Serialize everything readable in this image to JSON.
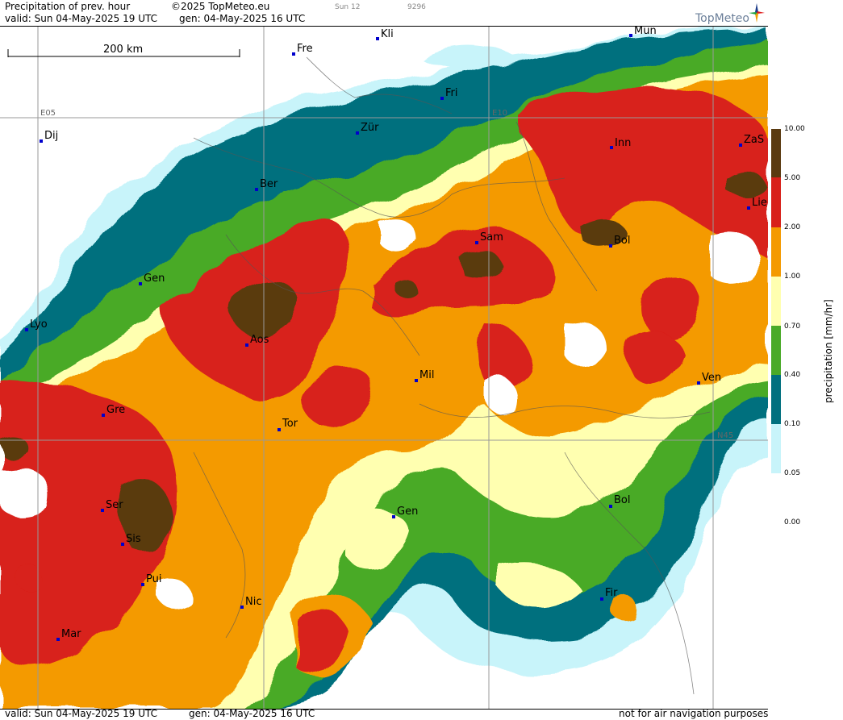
{
  "header": {
    "title": "Precipitation of prev. hour",
    "copyright": "©2025 TopMeteo.eu",
    "run_code": "Sun 12",
    "run_id": "9296",
    "valid": "valid:  Sun  04-May-2025  19 UTC",
    "gen": "gen: 04-May-2025 16 UTC",
    "logo_text": "TopMeteo"
  },
  "footer": {
    "valid": "valid:  Sun  04-May-2025  19 UTC",
    "gen": "gen: 04-May-2025 16 UTC",
    "disclaimer": "not for air navigation purposes"
  },
  "scale_bar": {
    "label": "200 km"
  },
  "grid": {
    "lon_e05": "E05",
    "lon_e10": "E10",
    "lat_n45": "N45"
  },
  "legend": {
    "title": "precipitation [mm/hr]",
    "levels": [
      {
        "value": "10.00",
        "color": "#5a3a10"
      },
      {
        "value": "5.00",
        "color": "#d8201a"
      },
      {
        "value": "2.00",
        "color": "#f49a00"
      },
      {
        "value": "1.00",
        "color": "#ffffb0"
      },
      {
        "value": "0.70",
        "color": "#4aaa28"
      },
      {
        "value": "0.40",
        "color": "#00707e"
      },
      {
        "value": "0.10",
        "color": "#c8f4fa"
      },
      {
        "value": "0.05",
        "color": "#ffffff"
      },
      {
        "value": "0.00",
        "color": "#ffffff"
      }
    ]
  },
  "cities": [
    {
      "id": "kli",
      "name": "Kli"
    },
    {
      "id": "mun",
      "name": "Mun"
    },
    {
      "id": "fre",
      "name": "Fre"
    },
    {
      "id": "fri",
      "name": "Fri"
    },
    {
      "id": "dij",
      "name": "Dij"
    },
    {
      "id": "zur",
      "name": "Zür"
    },
    {
      "id": "inn",
      "name": "Inn"
    },
    {
      "id": "zas",
      "name": "ZaS"
    },
    {
      "id": "ber",
      "name": "Ber"
    },
    {
      "id": "lie",
      "name": "Lie"
    },
    {
      "id": "sam",
      "name": "Sam"
    },
    {
      "id": "bol1",
      "name": "Bol"
    },
    {
      "id": "gen1",
      "name": "Gen"
    },
    {
      "id": "lyo",
      "name": "Lyo"
    },
    {
      "id": "aos",
      "name": "Aos"
    },
    {
      "id": "mil",
      "name": "Mil"
    },
    {
      "id": "ven",
      "name": "Ven"
    },
    {
      "id": "gre",
      "name": "Gre"
    },
    {
      "id": "tor",
      "name": "Tor"
    },
    {
      "id": "ser",
      "name": "Ser"
    },
    {
      "id": "gen2",
      "name": "Gen"
    },
    {
      "id": "bol2",
      "name": "Bol"
    },
    {
      "id": "sis",
      "name": "Sis"
    },
    {
      "id": "pui",
      "name": "Pui"
    },
    {
      "id": "nic",
      "name": "Nic"
    },
    {
      "id": "fir",
      "name": "Fir"
    },
    {
      "id": "mar",
      "name": "Mar"
    }
  ]
}
